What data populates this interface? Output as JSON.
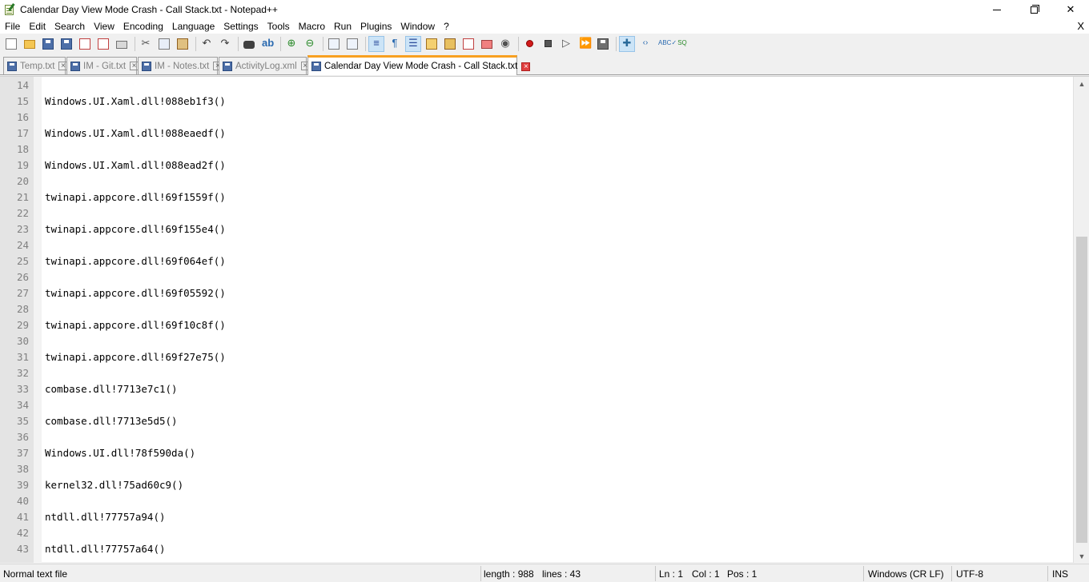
{
  "window": {
    "title": "Calendar Day View Mode Crash - Call Stack.txt - Notepad++",
    "close_glyph": "✕"
  },
  "menu": {
    "items": [
      "File",
      "Edit",
      "Search",
      "View",
      "Encoding",
      "Language",
      "Settings",
      "Tools",
      "Macro",
      "Run",
      "Plugins",
      "Window",
      "?"
    ],
    "close_glyph": "X"
  },
  "toolbar": {
    "icons": [
      "new-file-icon",
      "open-file-icon",
      "save-icon",
      "save-all-icon",
      "close-icon",
      "close-all-icon",
      "print-icon",
      "cut-icon",
      "copy-icon",
      "paste-icon",
      "undo-icon",
      "redo-icon",
      "find-icon",
      "replace-icon",
      "zoom-in-icon",
      "zoom-out-icon",
      "sync-vertical-icon",
      "sync-horizontal-icon",
      "word-wrap-icon",
      "show-all-chars-icon",
      "indent-guide-icon",
      "language-define-icon",
      "document-map-icon",
      "function-list-icon",
      "folder-workspace-icon",
      "monitoring-icon",
      "record-macro-icon",
      "stop-recording-icon",
      "playback-macro-icon",
      "run-macro-multiple-icon",
      "save-macro-icon",
      "plugin-icon",
      "xml-tools-icon",
      "spell-check-icon",
      "sql-icon"
    ]
  },
  "tabs": [
    {
      "label": "Temp.txt",
      "active": false
    },
    {
      "label": "IM - Git.txt",
      "active": false
    },
    {
      "label": "IM - Notes.txt",
      "active": false
    },
    {
      "label": "ActivityLog.xml",
      "active": false
    },
    {
      "label": "Calendar Day View Mode Crash - Call Stack.txt",
      "active": true
    }
  ],
  "editor": {
    "lines": [
      {
        "n": "14",
        "text": ""
      },
      {
        "n": "15",
        "text": "Windows.UI.Xaml.dll!088eb1f3()"
      },
      {
        "n": "16",
        "text": ""
      },
      {
        "n": "17",
        "text": "Windows.UI.Xaml.dll!088eaedf()"
      },
      {
        "n": "18",
        "text": ""
      },
      {
        "n": "19",
        "text": "Windows.UI.Xaml.dll!088ead2f()"
      },
      {
        "n": "20",
        "text": ""
      },
      {
        "n": "21",
        "text": "twinapi.appcore.dll!69f1559f()"
      },
      {
        "n": "22",
        "text": ""
      },
      {
        "n": "23",
        "text": "twinapi.appcore.dll!69f155e4()"
      },
      {
        "n": "24",
        "text": ""
      },
      {
        "n": "25",
        "text": "twinapi.appcore.dll!69f064ef()"
      },
      {
        "n": "26",
        "text": ""
      },
      {
        "n": "27",
        "text": "twinapi.appcore.dll!69f05592()"
      },
      {
        "n": "28",
        "text": ""
      },
      {
        "n": "29",
        "text": "twinapi.appcore.dll!69f10c8f()"
      },
      {
        "n": "30",
        "text": ""
      },
      {
        "n": "31",
        "text": "twinapi.appcore.dll!69f27e75()"
      },
      {
        "n": "32",
        "text": ""
      },
      {
        "n": "33",
        "text": "combase.dll!7713e7c1()"
      },
      {
        "n": "34",
        "text": ""
      },
      {
        "n": "35",
        "text": "combase.dll!7713e5d5()"
      },
      {
        "n": "36",
        "text": ""
      },
      {
        "n": "37",
        "text": "Windows.UI.dll!78f590da()"
      },
      {
        "n": "38",
        "text": ""
      },
      {
        "n": "39",
        "text": "kernel32.dll!75ad60c9()"
      },
      {
        "n": "40",
        "text": ""
      },
      {
        "n": "41",
        "text": "ntdll.dll!77757a94()"
      },
      {
        "n": "42",
        "text": ""
      },
      {
        "n": "43",
        "text": "ntdll.dll!77757a64()"
      }
    ]
  },
  "status": {
    "file_type": "Normal text file",
    "length": "length : 988",
    "lines": "lines : 43",
    "ln": "Ln : 1",
    "col": "Col : 1",
    "pos": "Pos : 1",
    "eol": "Windows (CR LF)",
    "encoding": "UTF-8",
    "mode": "INS"
  }
}
